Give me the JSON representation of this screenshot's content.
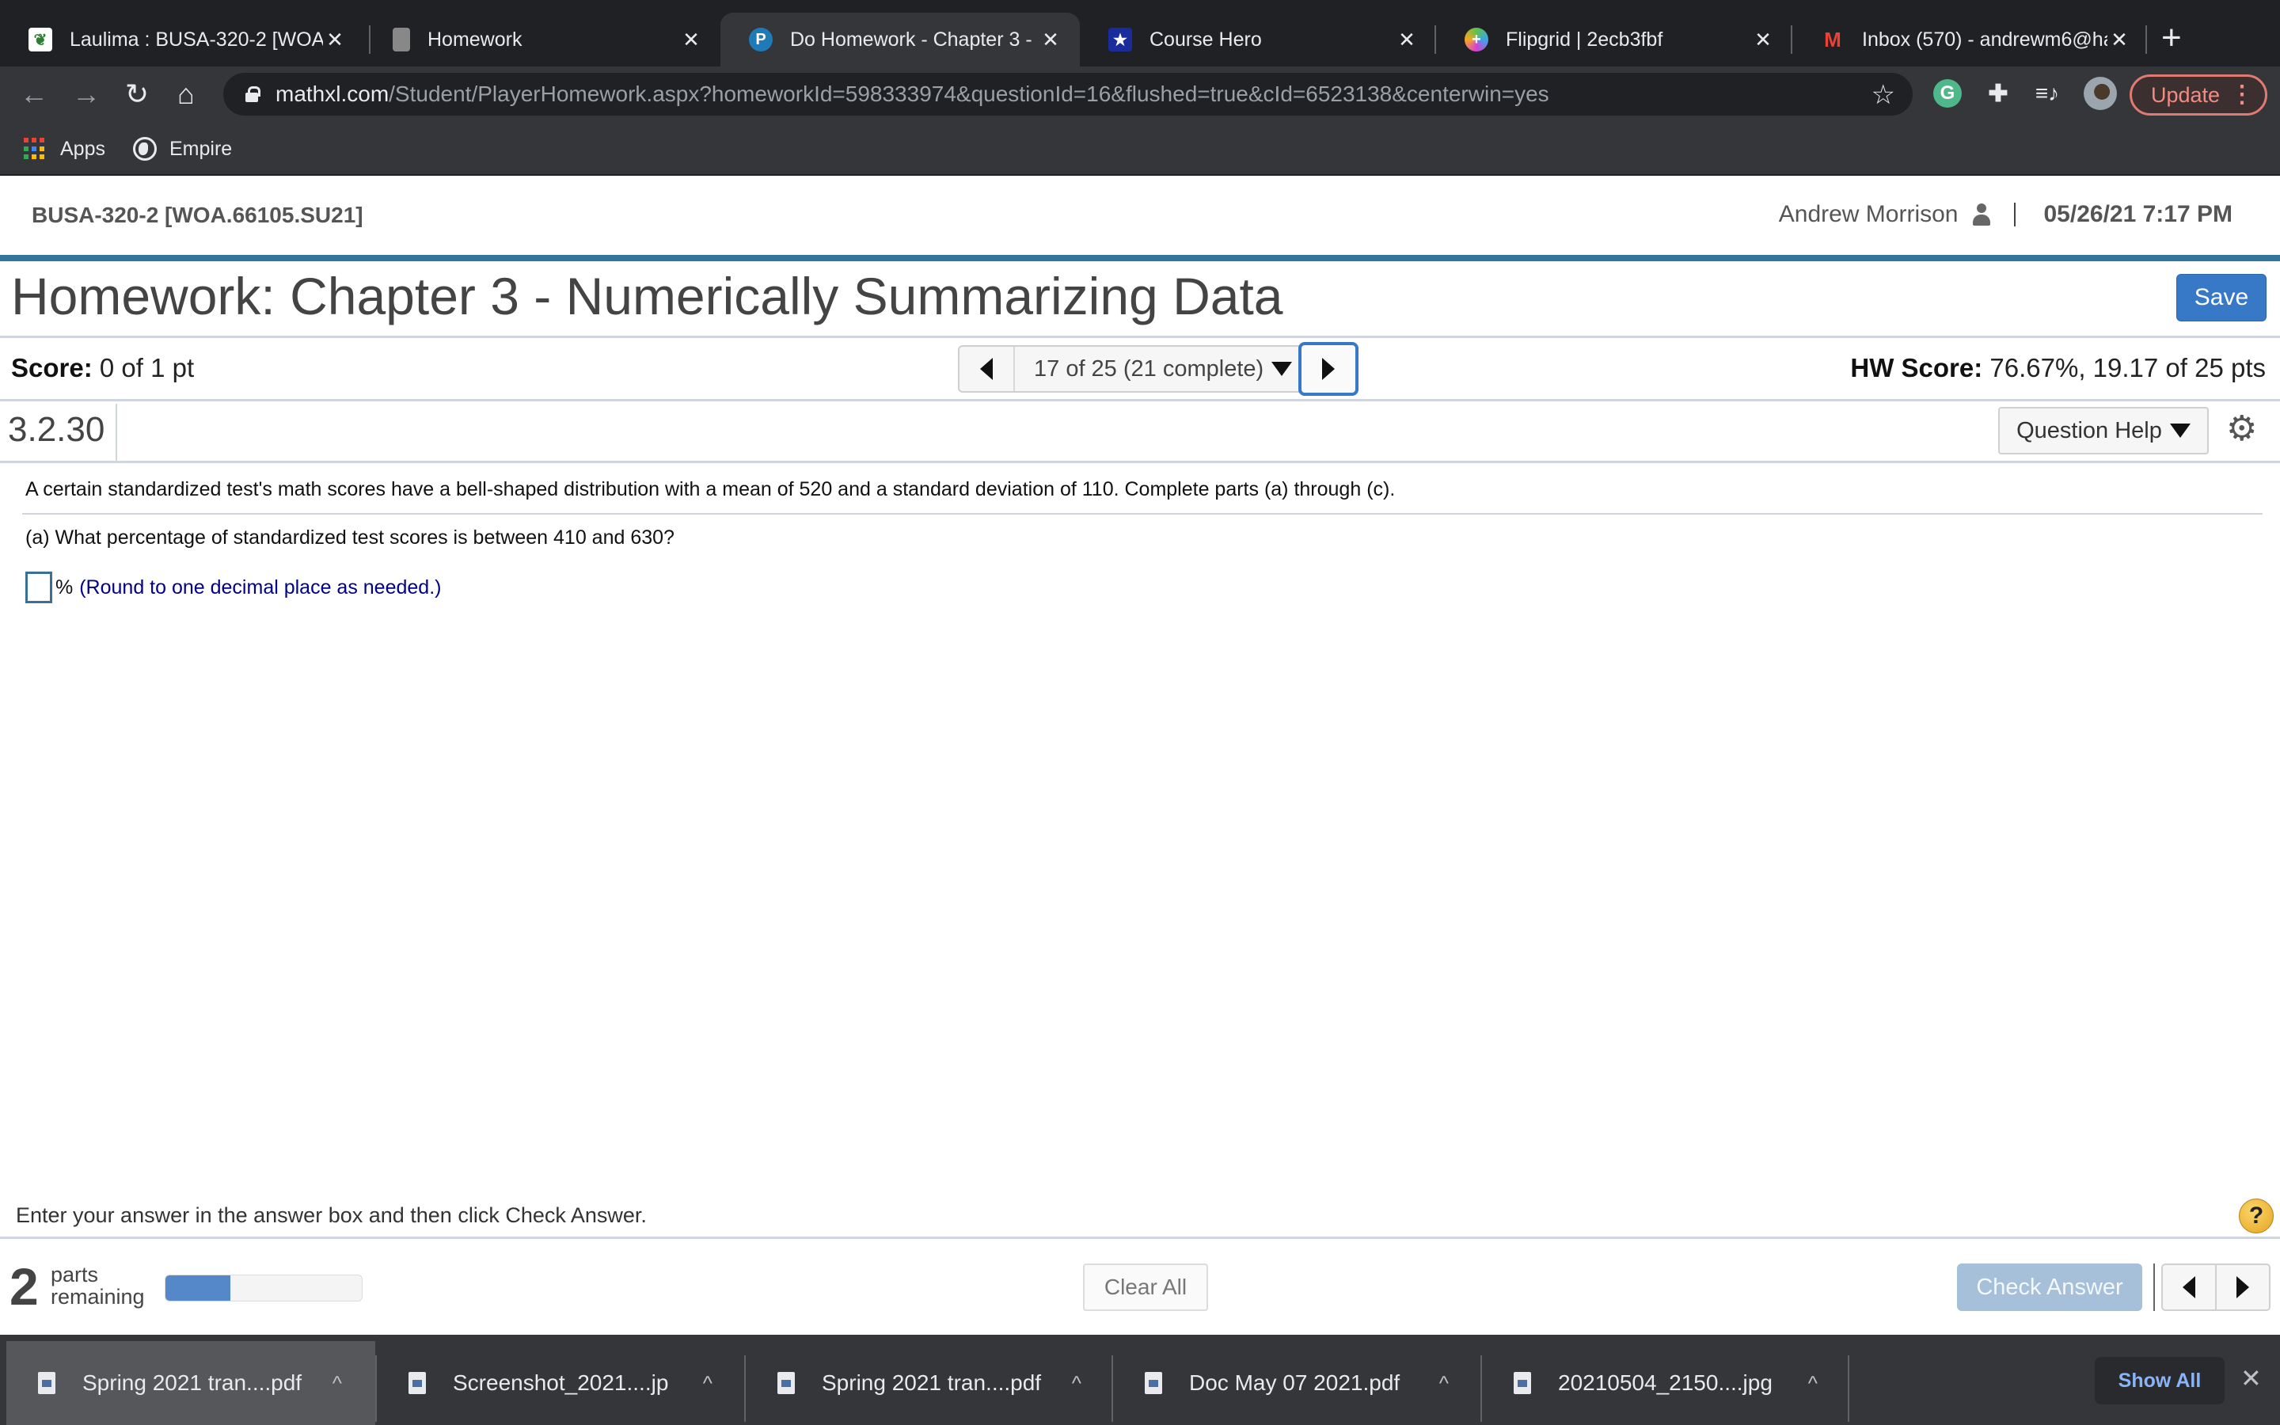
{
  "browser": {
    "tabs": [
      {
        "title": "Laulima : BUSA-320-2 [WOA",
        "icon": "laulima-leaf-icon",
        "active": false
      },
      {
        "title": "Homework",
        "icon": "document-icon",
        "active": false
      },
      {
        "title": "Do Homework - Chapter 3 -",
        "icon": "pearson-p-icon",
        "active": true
      },
      {
        "title": "Course Hero",
        "icon": "course-hero-star-icon",
        "active": false
      },
      {
        "title": "Flipgrid | 2ecb3fbf",
        "icon": "flipgrid-icon",
        "active": false
      },
      {
        "title": "Inbox (570) - andrewm6@ha",
        "icon": "gmail-icon",
        "active": false
      }
    ],
    "tab_close_glyph": "✕",
    "new_tab_glyph": "+",
    "url_host": "mathxl.com",
    "url_path": "/Student/PlayerHomework.aspx?homeworkId=598333974&questionId=16&flushed=true&cId=6523138&centerwin=yes",
    "update_label": "Update",
    "extensions": [
      "grammarly-icon",
      "puzzle-extensions-icon",
      "media-queue-icon",
      "profile-avatar"
    ],
    "bookmarks": [
      {
        "label": "Apps",
        "icon": "apps-grid-icon"
      },
      {
        "label": "Empire",
        "icon": "globe-icon"
      }
    ]
  },
  "course": {
    "name": "BUSA-320-2 [WOA.66105.SU21]",
    "user": "Andrew Morrison",
    "datetime": "05/26/21 7:17 PM"
  },
  "homework": {
    "title": "Homework: Chapter 3 - Numerically Summarizing Data",
    "save_label": "Save",
    "score_label": "Score:",
    "score_value": "0 of 1 pt",
    "question_selector": "17 of 25 (21 complete)",
    "hw_score_label": "HW Score:",
    "hw_score_value": "76.67%, 19.17 of 25 pts"
  },
  "question": {
    "number": "3.2.30",
    "help_label": "Question Help",
    "stem": "A certain standardized test's math scores have a bell-shaped distribution with a mean of 520 and a standard deviation of 110. Complete parts (a) through (c).",
    "part_a": "(a) What percentage of standardized test scores is between 410 and 630?",
    "answer_value": "",
    "answer_suffix": "%",
    "answer_hint": "(Round to one decimal place as needed.)"
  },
  "footer": {
    "instruction": "Enter your answer in the answer box and then click Check Answer.",
    "help_glyph": "?",
    "parts_remaining": "2",
    "parts_label_1": "parts",
    "parts_label_2": "remaining",
    "progress_fraction": 0.33,
    "clear_all_label": "Clear All",
    "check_answer_label": "Check Answer"
  },
  "colors": {
    "accent_line": "#347699",
    "primary_button": "#3778c7",
    "check_answer_disabled": "#a6c0da",
    "progress_fill": "#5588c8",
    "hint_text": "#00008b"
  },
  "downloads": {
    "items": [
      {
        "name": "Spring 2021 tran....pdf"
      },
      {
        "name": "Screenshot_2021....jp"
      },
      {
        "name": "Spring 2021 tran....pdf"
      },
      {
        "name": "Doc May 07 2021.pdf"
      },
      {
        "name": "20210504_2150....jpg"
      }
    ],
    "caret_glyph": "^",
    "show_all_label": "Show All",
    "close_glyph": "✕"
  }
}
